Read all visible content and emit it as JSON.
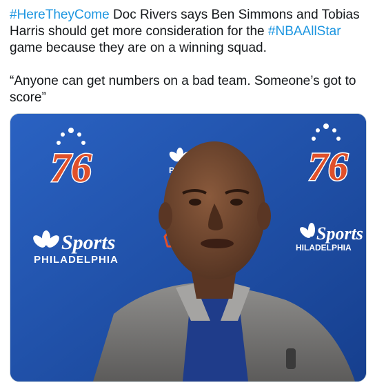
{
  "tweet": {
    "hashtag_1": "#HereTheyCome",
    "text_1a": " Doc Rivers says Ben Simmons and Tobias Harris should get more consideration for the ",
    "hashtag_2": "#NBAAllStar",
    "text_1b": " game because they are on a winning squad.",
    "quote": "“Anyone can get numbers on a bad team. Someone’s got to score”"
  },
  "media": {
    "backdrop_sponsor": "Sports",
    "backdrop_city_left": "PHILADELPHIA",
    "backdrop_city_right": "HILADELPHIA",
    "backdrop_city_partial": "PHIL",
    "logo_number_left": "76",
    "logo_number_right": "76",
    "colors": {
      "backdrop_blue": "#1d4fa8",
      "logo_red": "#e0502a",
      "hashtag_blue": "#1b95e0"
    }
  }
}
